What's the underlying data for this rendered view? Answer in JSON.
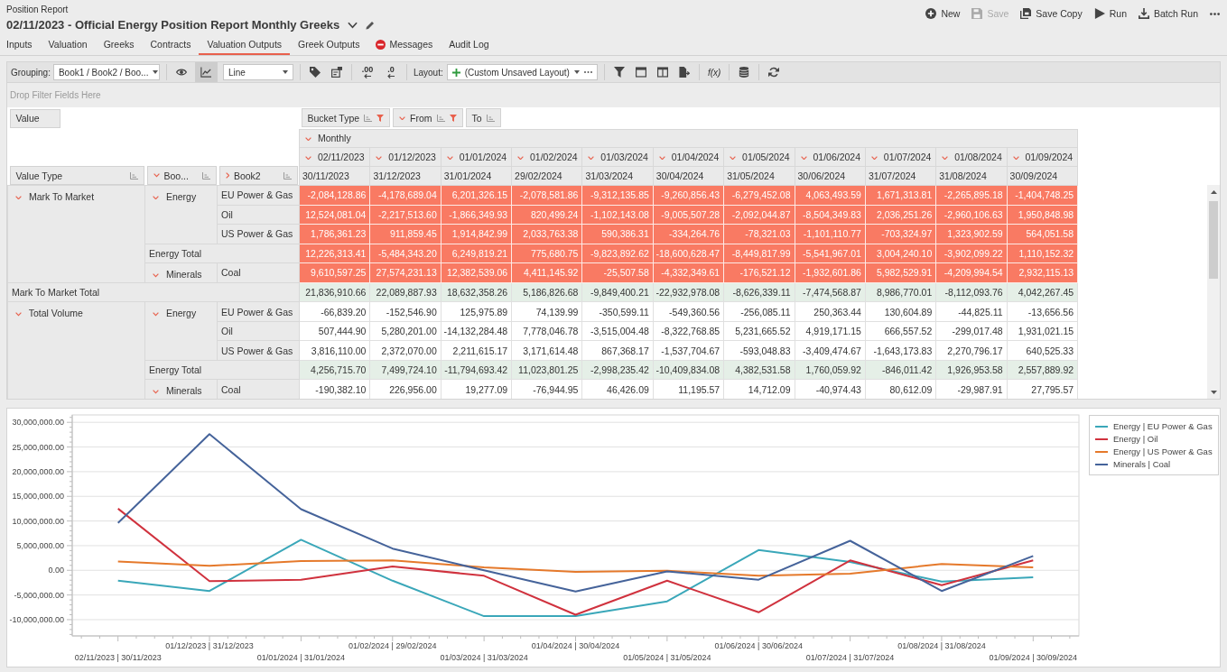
{
  "header": {
    "app_title": "Position Report",
    "report_title": "02/11/2023 - Official Energy Position Report Monthly Greeks",
    "actions": [
      {
        "label": "New",
        "disabled": false
      },
      {
        "label": "Save",
        "disabled": true
      },
      {
        "label": "Save Copy",
        "disabled": false
      },
      {
        "label": "Run",
        "disabled": false
      },
      {
        "label": "Batch Run",
        "disabled": false
      }
    ]
  },
  "tabs": [
    {
      "label": "Inputs",
      "selected": false,
      "kind": "plain"
    },
    {
      "label": "Valuation",
      "selected": false,
      "kind": "plain"
    },
    {
      "label": "Greeks",
      "selected": false,
      "kind": "plain"
    },
    {
      "label": "Contracts",
      "selected": false,
      "kind": "plain"
    },
    {
      "label": "Valuation Outputs",
      "selected": true,
      "kind": "plain"
    },
    {
      "label": "Greek Outputs",
      "selected": false,
      "kind": "plain"
    },
    {
      "label": "Messages",
      "selected": false,
      "kind": "error"
    },
    {
      "label": "Audit Log",
      "selected": false,
      "kind": "plain"
    }
  ],
  "toolbar": {
    "grouping_label": "Grouping:",
    "grouping_value": "Book1 / Book2 / Boo...",
    "chart_toggle": {
      "selected": true
    },
    "chart_type": "Line",
    "decimal_buttons": [
      ".00",
      ".0"
    ],
    "layout_label": "Layout:",
    "layout_value": "(Custom Unsaved Layout)",
    "formula_button": "f(x)"
  },
  "filter_area": {
    "placeholder": "Drop Filter Fields Here"
  },
  "pivot": {
    "data_field": "Value",
    "column_fields": [
      {
        "label": "Bucket Type",
        "kind": "plain",
        "filtered": true
      },
      {
        "label": "From",
        "kind": "group",
        "expanded": true,
        "filtered": true
      },
      {
        "label": "To",
        "kind": "plain",
        "filtered": false
      }
    ],
    "row_fields": [
      {
        "label": "Value Type",
        "kind": "plain"
      },
      {
        "label": "Boo...",
        "kind": "group",
        "expanded": true
      },
      {
        "label": "Book2",
        "kind": "group",
        "expanded": false
      }
    ],
    "column_group": {
      "label": "Monthly",
      "expanded": true
    },
    "columns": [
      {
        "from": "02/11/2023",
        "to": "30/11/2023",
        "expanded": true
      },
      {
        "from": "01/12/2023",
        "to": "31/12/2023",
        "expanded": true
      },
      {
        "from": "01/01/2024",
        "to": "31/01/2024",
        "expanded": true
      },
      {
        "from": "01/02/2024",
        "to": "29/02/2024",
        "expanded": true
      },
      {
        "from": "01/03/2024",
        "to": "31/03/2024",
        "expanded": true
      },
      {
        "from": "01/04/2024",
        "to": "30/04/2024",
        "expanded": true
      },
      {
        "from": "01/05/2024",
        "to": "31/05/2024",
        "expanded": true
      },
      {
        "from": "01/06/2024",
        "to": "30/06/2024",
        "expanded": true
      },
      {
        "from": "01/07/2024",
        "to": "31/07/2024",
        "expanded": true
      },
      {
        "from": "01/08/2024",
        "to": "31/08/2024",
        "expanded": true
      },
      {
        "from": "01/09/2024",
        "to": "30/09/2024",
        "expanded": true
      }
    ],
    "rows": [
      {
        "label": "Mark To Market",
        "expanded": true,
        "highlighted": true,
        "children": [
          {
            "label": "Energy",
            "expanded": true,
            "children": [
              {
                "label": "EU Power & Gas",
                "values": [
                  "-2,084,128.86",
                  "-4,178,689.04",
                  "6,201,326.15",
                  "-2,078,581.86",
                  "-9,312,135.85",
                  "-9,260,856.43",
                  "-6,279,452.08",
                  "4,063,493.59",
                  "1,671,313.81",
                  "-2,265,895.18",
                  "-1,404,748.25"
                ]
              },
              {
                "label": "Oil",
                "values": [
                  "12,524,081.04",
                  "-2,217,513.60",
                  "-1,866,349.93",
                  "820,499.24",
                  "-1,102,143.08",
                  "-9,005,507.28",
                  "-2,092,044.87",
                  "-8,504,349.83",
                  "2,036,251.26",
                  "-2,960,106.63",
                  "1,950,848.98"
                ]
              },
              {
                "label": "US Power & Gas",
                "values": [
                  "1,786,361.23",
                  "911,859.45",
                  "1,914,842.99",
                  "2,033,763.38",
                  "590,386.31",
                  "-334,264.76",
                  "-78,321.03",
                  "-1,101,110.77",
                  "-703,324.97",
                  "1,323,902.59",
                  "564,051.58"
                ]
              }
            ],
            "total": {
              "label": "Energy Total",
              "values": [
                "12,226,313.41",
                "-5,484,343.20",
                "6,249,819.21",
                "775,680.75",
                "-9,823,892.62",
                "-18,600,628.47",
                "-8,449,817.99",
                "-5,541,967.01",
                "3,004,240.10",
                "-3,902,099.22",
                "1,110,152.32"
              ]
            }
          },
          {
            "label": "Minerals",
            "expanded": true,
            "children": [
              {
                "label": "Coal",
                "values": [
                  "9,610,597.25",
                  "27,574,231.13",
                  "12,382,539.06",
                  "4,411,145.92",
                  "-25,507.58",
                  "-4,332,349.61",
                  "-176,521.12",
                  "-1,932,601.86",
                  "5,982,529.91",
                  "-4,209,994.54",
                  "2,932,115.13"
                ]
              }
            ]
          }
        ],
        "total": {
          "label": "Mark To Market Total",
          "values": [
            "21,836,910.66",
            "22,089,887.93",
            "18,632,358.26",
            "5,186,826.68",
            "-9,849,400.21",
            "-22,932,978.08",
            "-8,626,339.11",
            "-7,474,568.87",
            "8,986,770.01",
            "-8,112,093.76",
            "4,042,267.45"
          ]
        }
      },
      {
        "label": "Total Volume",
        "expanded": true,
        "highlighted": false,
        "children": [
          {
            "label": "Energy",
            "expanded": true,
            "children": [
              {
                "label": "EU Power & Gas",
                "values": [
                  "-66,839.20",
                  "-152,546.90",
                  "125,975.89",
                  "74,139.99",
                  "-350,599.11",
                  "-549,360.56",
                  "-256,085.11",
                  "250,363.44",
                  "130,604.89",
                  "-44,825.11",
                  "-13,656.56"
                ]
              },
              {
                "label": "Oil",
                "values": [
                  "507,444.90",
                  "5,280,201.00",
                  "-14,132,284.48",
                  "7,778,046.78",
                  "-3,515,004.48",
                  "-8,322,768.85",
                  "5,231,665.52",
                  "4,919,171.15",
                  "666,557.52",
                  "-299,017.48",
                  "1,931,021.15"
                ]
              },
              {
                "label": "US Power & Gas",
                "values": [
                  "3,816,110.00",
                  "2,372,070.00",
                  "2,211,615.17",
                  "3,171,614.48",
                  "867,368.17",
                  "-1,537,704.67",
                  "-593,048.83",
                  "-3,409,474.67",
                  "-1,643,173.83",
                  "2,270,796.17",
                  "640,525.33"
                ]
              }
            ],
            "total": {
              "label": "Energy Total",
              "values": [
                "4,256,715.70",
                "7,499,724.10",
                "-11,794,693.42",
                "11,023,801.25",
                "-2,998,235.42",
                "-10,409,834.08",
                "4,382,531.58",
                "1,760,059.92",
                "-846,011.42",
                "1,926,953.58",
                "2,557,889.92"
              ]
            }
          },
          {
            "label": "Minerals",
            "expanded": true,
            "children": [
              {
                "label": "Coal",
                "values": [
                  "-190,382.10",
                  "226,956.00",
                  "19,277.09",
                  "-76,944.95",
                  "46,426.09",
                  "11,195.57",
                  "14,712.09",
                  "-40,974.43",
                  "80,612.09",
                  "-29,987.91",
                  "27,795.57"
                ]
              }
            ]
          }
        ]
      }
    ]
  },
  "chart": {
    "chart_data": {
      "type": "line",
      "categories": [
        "02/11/2023 | 30/11/2023",
        "01/12/2023 | 31/12/2023",
        "01/01/2024 | 31/01/2024",
        "01/02/2024 | 29/02/2024",
        "01/03/2024 | 31/03/2024",
        "01/04/2024 | 30/04/2024",
        "01/05/2024 | 31/05/2024",
        "01/06/2024 | 30/06/2024",
        "01/07/2024 | 31/07/2024",
        "01/08/2024 | 31/08/2024",
        "01/09/2024 | 30/09/2024"
      ],
      "series": [
        {
          "name": "Energy | EU Power & Gas",
          "color": "#3aa7b9",
          "values": [
            -2100000,
            -4200000,
            6200000,
            -2100000,
            -9300000,
            -9300000,
            -6300000,
            4100000,
            1700000,
            -2300000,
            -1400000
          ]
        },
        {
          "name": "Energy | Oil",
          "color": "#d0323e",
          "values": [
            12500000,
            -2200000,
            -1900000,
            800000,
            -1100000,
            -9000000,
            -2100000,
            -8500000,
            2000000,
            -3000000,
            2000000
          ]
        },
        {
          "name": "Energy | US Power & Gas",
          "color": "#e5792b",
          "values": [
            1800000,
            900000,
            1900000,
            2000000,
            600000,
            -300000,
            -100000,
            -1100000,
            -700000,
            1300000,
            600000
          ]
        },
        {
          "name": "Minerals | Coal",
          "color": "#45639a",
          "values": [
            9600000,
            27600000,
            12400000,
            4400000,
            0,
            -4300000,
            -200000,
            -1900000,
            6000000,
            -4200000,
            2900000
          ]
        }
      ],
      "ylim": [
        -13300000,
        31500000
      ],
      "yticks": [
        {
          "value": -10000000,
          "label": "-10,000,000.00"
        },
        {
          "value": -5000000,
          "label": "-5,000,000.00"
        },
        {
          "value": 0,
          "label": "0.00"
        },
        {
          "value": 5000000,
          "label": "5,000,000.00"
        },
        {
          "value": 10000000,
          "label": "10,000,000.00"
        },
        {
          "value": 15000000,
          "label": "15,000,000.00"
        },
        {
          "value": 20000000,
          "label": "20,000,000.00"
        },
        {
          "value": 25000000,
          "label": "25,000,000.00"
        },
        {
          "value": 30000000,
          "label": "30,000,000.00"
        }
      ],
      "grid": true
    }
  }
}
